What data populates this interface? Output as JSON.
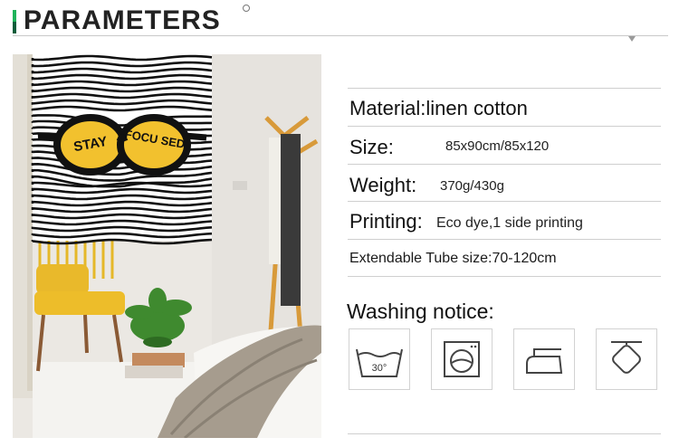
{
  "header": {
    "title": "PARAMETERS"
  },
  "specs": [
    {
      "label": "Material:",
      "value": "linen cotton"
    },
    {
      "label": "Size:",
      "value": "85x90cm/85x120"
    },
    {
      "label": "Weight:",
      "value": "370g/430g"
    },
    {
      "label": "Printing:",
      "value": "Eco dye,1 side printing"
    },
    {
      "label": "Extendable Tube size:",
      "value": "70-120cm"
    }
  ],
  "washing": {
    "title": "Washing notice:",
    "icons": [
      {
        "name": "wash-30-icon",
        "text": "30°"
      },
      {
        "name": "tumble-dry-icon"
      },
      {
        "name": "iron-icon"
      },
      {
        "name": "hang-dry-icon"
      }
    ]
  },
  "curtain": {
    "left_text": "STAY",
    "right_text": "FOCU SED"
  },
  "colors": {
    "accent_green": "#1fb35a",
    "dark_green": "#0b5d3a",
    "lens_yellow": "#f2c12e"
  }
}
